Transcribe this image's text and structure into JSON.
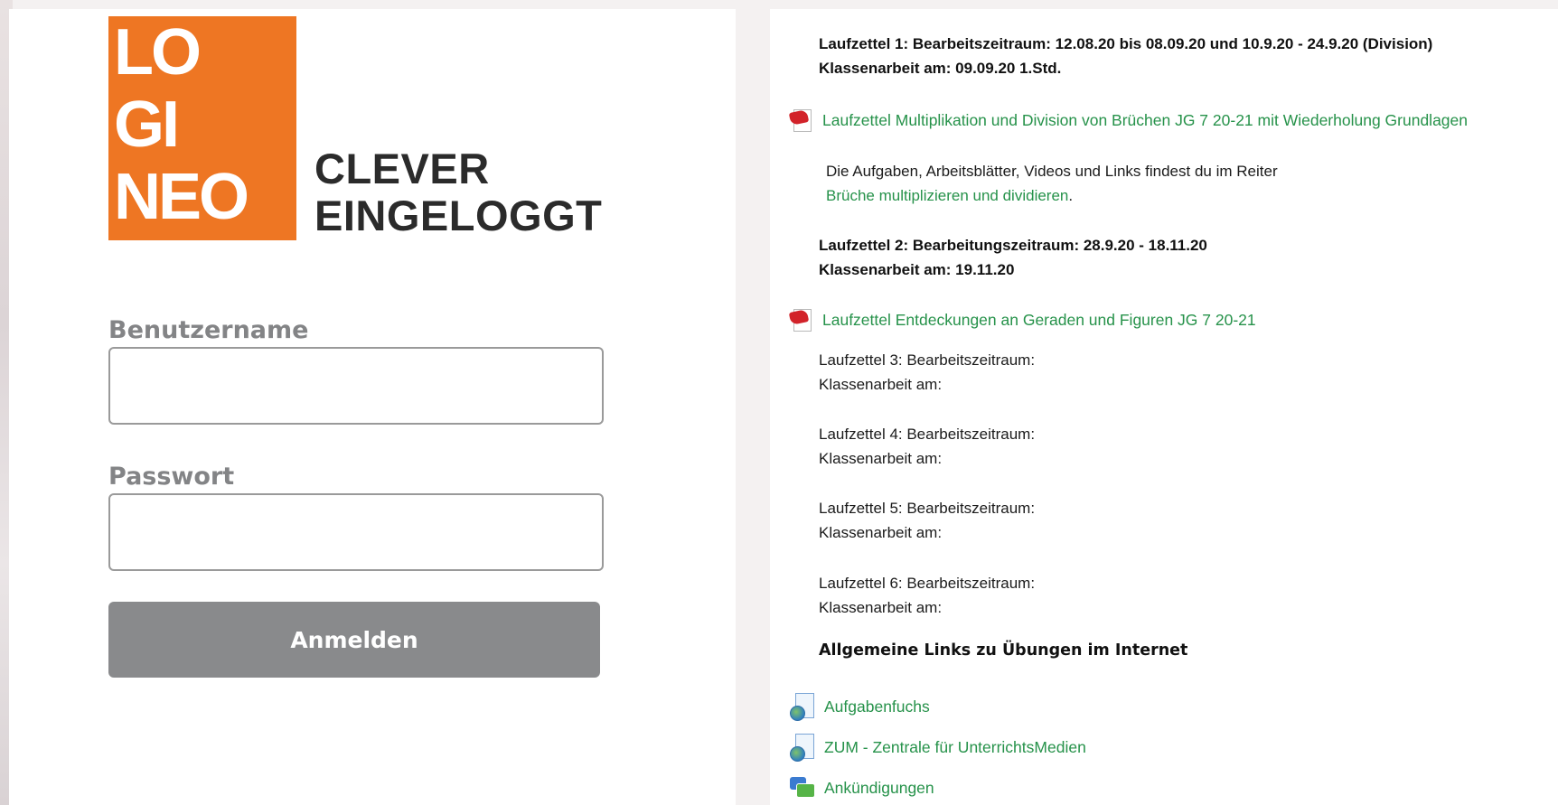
{
  "login": {
    "logo_lines": [
      "LO",
      "GI",
      "NEO"
    ],
    "tagline": [
      "CLEVER",
      "EINGELOGGT"
    ],
    "username_label": "Benutzername",
    "username_value": "",
    "password_label": "Passwort",
    "password_value": "",
    "submit_label": "Anmelden"
  },
  "course": {
    "sheet1": {
      "title": "Laufzettel 1: Bearbeitszeitraum: 12.08.20 bis 08.09.20 und 10.9.20 - 24.9.20 (Division)",
      "exam": "Klassenarbeit am: 09.09.20 1.Std."
    },
    "file1": {
      "label": "Laufzettel Multiplikation und Division von Brüchen JG 7 20-21 mit Wiederholung Grundlagen",
      "icon": "pdf-icon"
    },
    "info": {
      "text": "Die Aufgaben, Arbeitsblätter, Videos und Links findest du im Reiter",
      "link": "Brüche multiplizieren und dividieren",
      "suffix": "."
    },
    "sheet2": {
      "title": "Laufzettel 2: Bearbeitungszeitraum: 28.9.20 - 18.11.20",
      "exam": "Klassenarbeit am: 19.11.20"
    },
    "file2": {
      "label": "Laufzettel Entdeckungen an Geraden und Figuren JG 7 20-21",
      "icon": "pdf-icon"
    },
    "sheets_pending": [
      {
        "title": "Laufzettel 3: Bearbeitszeitraum:",
        "exam": "Klassenarbeit am:"
      },
      {
        "title": "Laufzettel 4: Bearbeitszeitraum:",
        "exam": "Klassenarbeit am:"
      },
      {
        "title": "Laufzettel 5: Bearbeitszeitraum:",
        "exam": "Klassenarbeit am:"
      },
      {
        "title": "Laufzettel 6: Bearbeitszeitraum:",
        "exam": "Klassenarbeit am:"
      }
    ],
    "links_heading": "Allgemeine Links zu Übungen im Internet",
    "links": [
      {
        "label": "Aufgabenfuchs",
        "icon": "web-link-icon"
      },
      {
        "label": "ZUM - Zentrale für UnterrichtsMedien",
        "icon": "web-link-icon"
      },
      {
        "label": "Ankündigungen",
        "icon": "forum-icon"
      }
    ]
  },
  "colors": {
    "brand_orange": "#ee7623",
    "link_green": "#26924a",
    "button_gray": "#898a8c",
    "label_gray": "#838486"
  }
}
